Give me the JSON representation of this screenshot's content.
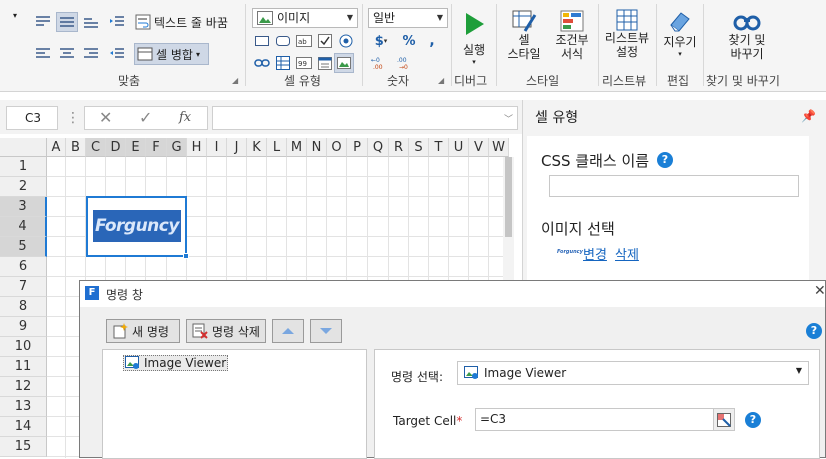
{
  "ribbon": {
    "wrap_text_label": "텍스트 줄 바꿈",
    "merge_label": "셀 병합",
    "alignment_group": "맞춤",
    "cell_type_value": "이미지",
    "cell_type_group": "셀 유형",
    "number_format_value": "일반",
    "number_group": "숫자",
    "run_label": "실행",
    "debug_group": "디버그",
    "cell_style_label": "셀\n스타일",
    "cond_format_label": "조건부\n서식",
    "style_group": "스타일",
    "listview_settings_label": "리스트뷰\n설정",
    "listview_group": "리스트뷰",
    "clear_label": "지우기",
    "edit_group": "편집",
    "find_replace_label": "찾기 및\n바꾸기",
    "find_group": "찾기 및 바꾸기"
  },
  "formula_bar": {
    "name_box": "C3",
    "cancel_symbol": "✕",
    "enter_symbol": "✓",
    "fx_symbol": "fx",
    "formula_value": ""
  },
  "sheet": {
    "columns": [
      "A",
      "B",
      "C",
      "D",
      "E",
      "F",
      "G",
      "H",
      "I",
      "J",
      "K",
      "L",
      "M",
      "N",
      "O",
      "P",
      "Q",
      "R",
      "S",
      "T",
      "U",
      "V",
      "W"
    ],
    "rows": [
      "1",
      "2",
      "3",
      "4",
      "5",
      "6",
      "7",
      "8",
      "9",
      "10",
      "11",
      "12",
      "13",
      "14",
      "15"
    ],
    "image_text": "Forguncy"
  },
  "panel": {
    "title": "셀 유형",
    "css_label": "CSS 클래스 이름",
    "css_value": "",
    "image_select_label": "이미지 선택",
    "thumb_text": "Forguncy",
    "change_link": "변경",
    "delete_link": "삭제"
  },
  "dialog": {
    "title": "명령 창",
    "new_cmd": "새 명령",
    "delete_cmd": "명령 삭제",
    "tree_item": "Image Viewer",
    "select_label": "명령 선택:",
    "select_value": "Image Viewer",
    "target_label": "Target Cell",
    "target_required": "*",
    "target_value": "=C3"
  },
  "colors": {
    "accent": "#1f7ad4",
    "run_green": "#1e9e3a",
    "help_blue": "#1a7fd6",
    "selection_header": "#d6d6d6"
  }
}
